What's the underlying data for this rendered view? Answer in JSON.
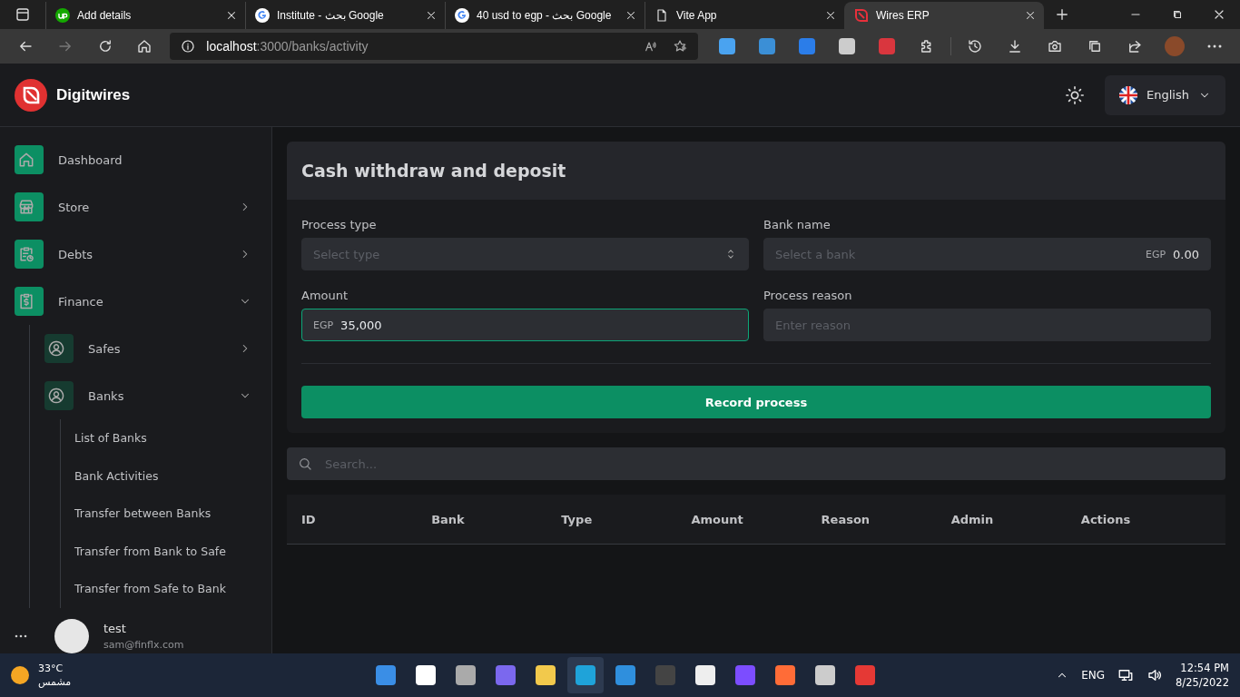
{
  "browser": {
    "tabs": [
      {
        "title": "Add details",
        "selected": false
      },
      {
        "title": "Institute - بحث Google",
        "selected": false
      },
      {
        "title": "40 usd to egp - بحث Google",
        "selected": false
      },
      {
        "title": "Vite App",
        "selected": false
      },
      {
        "title": "Wires ERP",
        "selected": true
      }
    ],
    "forward_disabled": true,
    "address": {
      "host": "localhost",
      "path": ":3000/banks/activity"
    }
  },
  "header": {
    "brand": "Digitwires",
    "language": "English"
  },
  "sidebar": {
    "items": [
      {
        "label": "Dashboard"
      },
      {
        "label": "Store",
        "expanded": false
      },
      {
        "label": "Debts",
        "expanded": false
      },
      {
        "label": "Finance",
        "expanded": true,
        "children": [
          {
            "label": "Safes",
            "expanded": false
          },
          {
            "label": "Banks",
            "expanded": true,
            "children": [
              {
                "label": "List of Banks"
              },
              {
                "label": "Bank Activities"
              },
              {
                "label": "Transfer between Banks"
              },
              {
                "label": "Transfer from Bank to Safe"
              },
              {
                "label": "Transfer from Safe to Bank"
              }
            ]
          }
        ]
      }
    ],
    "user": {
      "name": "test",
      "email": "sam@finflx.com"
    }
  },
  "form": {
    "title": "Cash withdraw and deposit",
    "fields": [
      {
        "label": "Process type",
        "kind": "select",
        "placeholder": "Select type",
        "focused": false
      },
      {
        "label": "Bank name",
        "kind": "balance",
        "placeholder": "Select a bank",
        "currency": "EGP",
        "balance": "0.00",
        "focused": false
      },
      {
        "label": "Amount",
        "kind": "money",
        "currency": "EGP",
        "value": "35,000",
        "focused": true
      },
      {
        "label": "Process reason",
        "kind": "text",
        "placeholder": "Enter reason",
        "focused": false
      }
    ],
    "button": "Record process"
  },
  "search": {
    "placeholder": "Search..."
  },
  "table": {
    "columns": [
      "ID",
      "Bank",
      "Type",
      "Amount",
      "Reason",
      "Admin",
      "Actions"
    ]
  },
  "taskbar": {
    "temperature": "33°C",
    "condition": "مشمس",
    "language": "ENG",
    "time": "12:54 PM",
    "date": "8/25/2022"
  }
}
